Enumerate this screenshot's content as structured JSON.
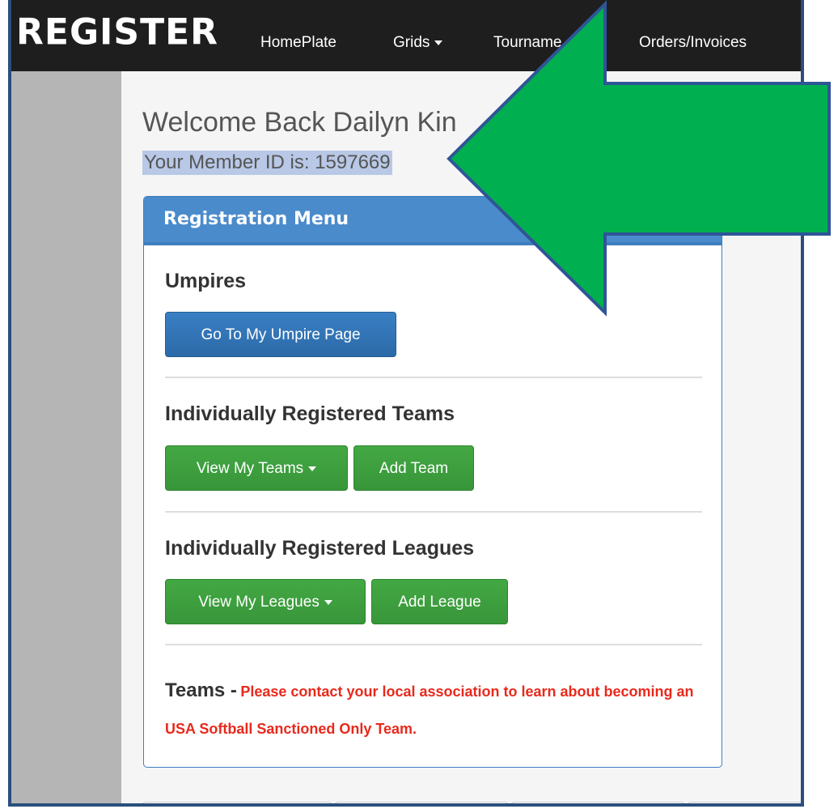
{
  "navbar": {
    "brand": "REGISTER",
    "items": [
      {
        "label": "HomePlate"
      },
      {
        "label": "Grids"
      },
      {
        "label": "Tourname"
      },
      {
        "label": "Orders/Invoices"
      }
    ]
  },
  "welcome": {
    "greeting": "Welcome Back Dailyn Kin",
    "member_id": "Your Member ID is: 1597669"
  },
  "registration_menu": {
    "title": "Registration Menu",
    "umpires": {
      "title": "Umpires",
      "button": "Go To My Umpire Page"
    },
    "teams": {
      "title": "Individually Registered Teams",
      "view_button": "View My Teams",
      "add_button": "Add Team"
    },
    "leagues": {
      "title": "Individually Registered Leagues",
      "view_button": "View My Leagues",
      "add_button": "Add League"
    },
    "sanctioned": {
      "label": "Teams -",
      "note": "Please contact your local association to learn about becoming an USA Softball Sanctioned Only Team."
    }
  },
  "colors": {
    "navbar": "#1e1e1e",
    "panel_heading": "#4a8bcc",
    "primary_button": "#337ab7",
    "success_button": "#3c9d3c",
    "warning_text": "#e8291c",
    "highlight": "#b8c8e6",
    "arrow": "#00b050",
    "frame_border": "#2b4e7e"
  }
}
